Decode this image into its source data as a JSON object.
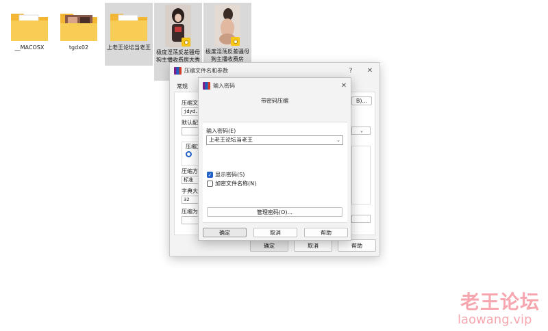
{
  "desktop": {
    "files": [
      {
        "label": "__MACOSX",
        "kind": "folder"
      },
      {
        "label": "tgdx02",
        "kind": "folder"
      },
      {
        "label": "上老王论坛当老王",
        "kind": "folder"
      },
      {
        "label": "极度淫荡反差骚母狗主播收费房大秀被操",
        "kind": "video",
        "badge": "Player"
      },
      {
        "label": "极度淫荡反差骚母狗主播收费房",
        "kind": "video",
        "badge": "Player"
      }
    ]
  },
  "archive_dialog": {
    "title": "压缩文件名和参数",
    "help_glyph": "?",
    "close_glyph": "✕",
    "tab_general": "常规",
    "label_archive_name": "压缩文",
    "archive_name_value": "jdyd.r",
    "browse_button_tail": "B)...",
    "label_default_profile": "默认配",
    "label_compress_format": "压缩文",
    "label_compress_method": "压缩方",
    "compress_method_value": "标准",
    "label_dict_size": "字典大",
    "dict_size_value": "32",
    "label_split": "压缩为",
    "ok_label": "确定",
    "cancel_label": "取消",
    "help_label": "帮助"
  },
  "password_dialog": {
    "title": "输入密码",
    "close_glyph": "✕",
    "subtitle": "带密码压缩",
    "password_label": "输入密码(E)",
    "password_value": "上老王论坛当老王",
    "show_password_label": "显示密码(S)",
    "show_password_checked": true,
    "encrypt_names_label": "加密文件名称(N)",
    "encrypt_names_checked": false,
    "manage_button_label": "管理密码(O)...",
    "ok_label": "确定",
    "cancel_label": "取消",
    "help_label": "帮助"
  },
  "watermark": {
    "cn": "老王论坛",
    "en": "laowang.vip"
  },
  "colors": {
    "folder_yellow": "#f5c542",
    "checkbox_blue": "#2161c8",
    "watermark_pink": "#f6a6ae"
  }
}
